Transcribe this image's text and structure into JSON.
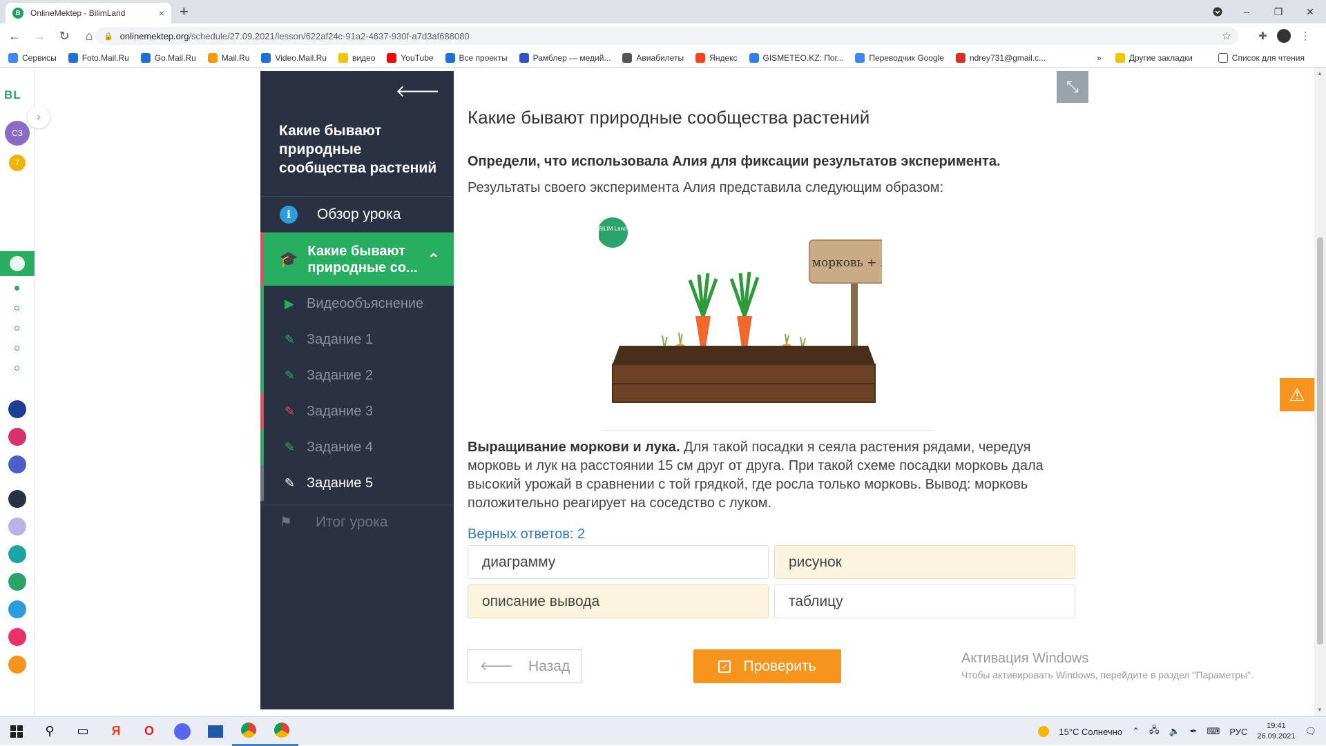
{
  "browser": {
    "tab_title": "OnlineMektep - BilimLand",
    "tab_favicon": "B",
    "new_tab": "+",
    "close_tab": "×",
    "url_domain": "onlinemektep.org",
    "url_path": "/schedule/27.09.2021/lesson/622af24c-91a2-4637-930f-a7d3af688080",
    "window_controls": [
      "–",
      "❐",
      "✕"
    ],
    "bookmarks": [
      {
        "label": "Сервисы",
        "color": "#4285f4",
        "icon": "apps-icon"
      },
      {
        "label": "Foto.Mail.Ru",
        "color": "#1e6fd8",
        "icon": "foto-mail-icon"
      },
      {
        "label": "Go.Mail.Ru",
        "color": "#1e6fd8",
        "icon": "go-mail-icon"
      },
      {
        "label": "Mail.Ru",
        "color": "#f59c00",
        "icon": "mail-ru-icon"
      },
      {
        "label": "Video.Mail.Ru",
        "color": "#1e6fd8",
        "icon": "video-mail-icon"
      },
      {
        "label": "видео",
        "color": "#f5c400",
        "icon": "video-icon"
      },
      {
        "label": "YouTube",
        "color": "#ff0000",
        "icon": "youtube-icon"
      },
      {
        "label": "Все проекты",
        "color": "#1e6fd8",
        "icon": "projects-icon"
      },
      {
        "label": "Рамблер — медий...",
        "color": "#3151c6",
        "icon": "rambler-icon"
      },
      {
        "label": "Авиабилеты",
        "color": "#555555",
        "icon": "plane-icon"
      },
      {
        "label": "Яндекс",
        "color": "#fc3f1d",
        "icon": "yandex-icon"
      },
      {
        "label": "GISMETEO.KZ: Пог...",
        "color": "#2f80ed",
        "icon": "gismeteo-icon"
      },
      {
        "label": "Переводчик Google",
        "color": "#4285f4",
        "icon": "translate-icon"
      },
      {
        "label": "ndrey731@gmail.c...",
        "color": "#d93025",
        "icon": "gmail-icon"
      }
    ],
    "bookmarks_more": "»",
    "other_bookmarks": "Другие закладки",
    "reading_list": "Список для чтения"
  },
  "rail": {
    "logo": "BL",
    "user_initials": "СЗ",
    "badge": "7"
  },
  "sidebar": {
    "title": "Какие бывают природные сообщества растений",
    "overview": "Обзор урока",
    "current_section": "Какие бывают природные со...",
    "items": [
      {
        "label": "Видеообъяснение"
      },
      {
        "label": "Задание 1"
      },
      {
        "label": "Задание 2"
      },
      {
        "label": "Задание 3"
      },
      {
        "label": "Задание 4"
      },
      {
        "label": "Задание 5"
      }
    ],
    "summary": "Итог урока"
  },
  "content": {
    "lesson_title": "Какие бывают природные сообщества растений",
    "question": "Определи, что использовала Алия для фиксации результатов эксперимента.",
    "subtext": "Результаты своего эксперимента Алия представила следующим образом:",
    "illustration": {
      "logo_text": "BILIM Land",
      "sign_text": "морковь + лук"
    },
    "description_bold": "Выращивание моркови и лука.",
    "description_text": " Для такой посадки я сеяла растения рядами, чередуя морковь и лук на расстоянии 15 см друг от друга. При такой схеме посадки морковь дала высокий урожай в сравнении с той грядкой, где росла только морковь. Вывод: морковь положительно реагирует на соседство с луком.",
    "correct_count": "Верных ответов: 2",
    "answers": [
      {
        "label": "диаграмму",
        "selected": false
      },
      {
        "label": "рисунок",
        "selected": true
      },
      {
        "label": "описание вывода",
        "selected": true
      },
      {
        "label": "таблицу",
        "selected": false
      }
    ],
    "back_button": "Назад",
    "check_button": "Проверить"
  },
  "watermark": {
    "line1": "Активация Windows",
    "line2": "Чтобы активировать Windows, перейдите в раздел \"Параметры\"."
  },
  "taskbar": {
    "weather": "15°C Солнечно",
    "language": "РУС",
    "time": "19:41",
    "date": "26.09.2021"
  },
  "colors": {
    "accent_green": "#27ae60",
    "sidebar_bg": "#2a3142",
    "check_orange": "#f7941d",
    "selected_answer_bg": "#fdf4e0",
    "link_blue": "#2d7bb8"
  }
}
